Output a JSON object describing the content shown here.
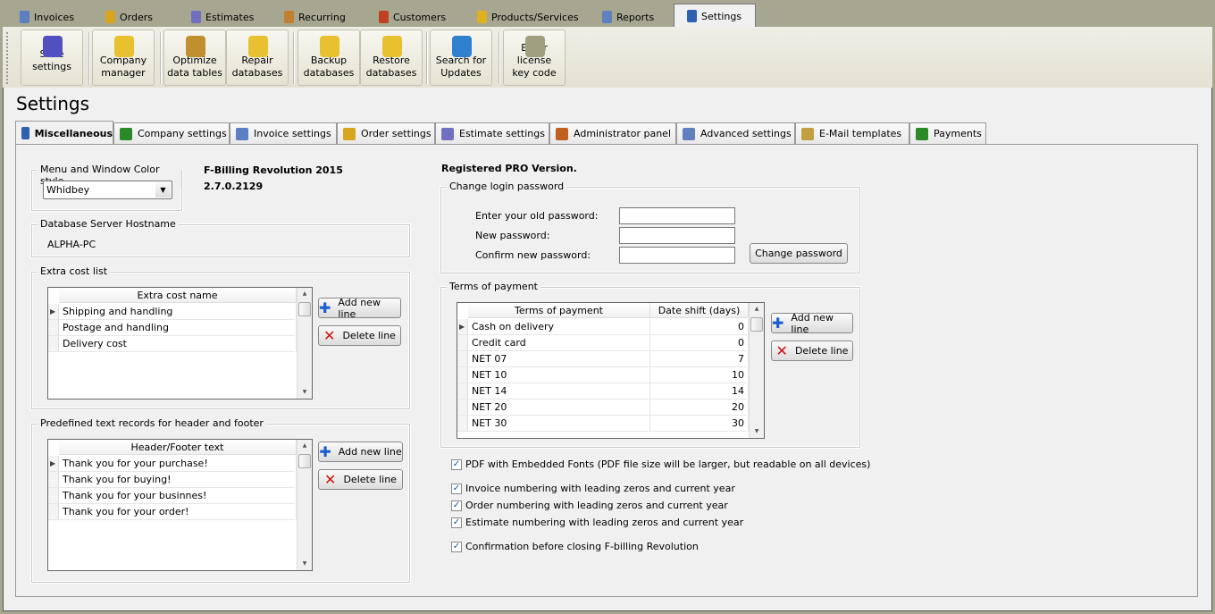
{
  "top_tabs": [
    "Invoices",
    "Orders",
    "Estimates",
    "Recurring",
    "Customers",
    "Products/Services",
    "Reports",
    "Settings"
  ],
  "active_top_tab": "Settings",
  "toolbar": [
    {
      "l1": "Save  settings",
      "l2": ""
    },
    {
      "l1": "Company",
      "l2": "manager"
    },
    {
      "l1": "Optimize",
      "l2": "data tables"
    },
    {
      "l1": "Repair",
      "l2": "databases"
    },
    {
      "l1": "Backup",
      "l2": "databases"
    },
    {
      "l1": "Restore",
      "l2": "databases"
    },
    {
      "l1": "Search for",
      "l2": "Updates"
    },
    {
      "l1": "Enter license",
      "l2": "key code"
    }
  ],
  "page_title": "Settings",
  "settings_tabs": [
    "Miscellaneous",
    "Company settings",
    "Invoice settings",
    "Order settings",
    "Estimate settings",
    "Administrator panel",
    "Advanced settings",
    "E-Mail templates",
    "Payments"
  ],
  "color_style": {
    "label": "Menu and Window Color style",
    "value": "Whidbey"
  },
  "product": {
    "name": "F-Billing Revolution 2015",
    "version": "2.7.0.2129",
    "registration": "Registered PRO Version."
  },
  "db_server": {
    "label": "Database Server Hostname",
    "value": "ALPHA-PC"
  },
  "extra_cost": {
    "label": "Extra cost list",
    "header": "Extra cost name",
    "rows": [
      "Shipping and handling",
      "Postage and handling",
      "Delivery cost"
    ]
  },
  "header_footer": {
    "label": "Predefined text records for header and footer",
    "header": "Header/Footer text",
    "rows": [
      "Thank you for your purchase!",
      "Thank you for buying!",
      "Thank you for your businnes!",
      "Thank you for your order!"
    ]
  },
  "buttons": {
    "add": "Add new line",
    "delete": "Delete line",
    "change_password": "Change password"
  },
  "password": {
    "label": "Change login password",
    "old": "Enter your old password:",
    "new": "New password:",
    "confirm": "Confirm new password:"
  },
  "terms": {
    "label": "Terms of payment",
    "headers": [
      "Terms of payment",
      "Date shift (days)"
    ],
    "rows": [
      [
        "Cash on delivery",
        "0"
      ],
      [
        "Credit card",
        "0"
      ],
      [
        "NET 07",
        "7"
      ],
      [
        "NET 10",
        "10"
      ],
      [
        "NET 14",
        "14"
      ],
      [
        "NET 20",
        "20"
      ],
      [
        "NET 30",
        "30"
      ]
    ]
  },
  "options": [
    {
      "label": "PDF with Embedded Fonts  (PDF file size will be larger, but readable on all devices)",
      "checked": true
    },
    {
      "label": "Invoice numbering with leading zeros and current year",
      "checked": true
    },
    {
      "label": "Order numbering with leading zeros and current year",
      "checked": true
    },
    {
      "label": "Estimate numbering with leading zeros and current year",
      "checked": true
    },
    {
      "label": "Confirmation before closing F-billing Revolution",
      "checked": true
    }
  ]
}
